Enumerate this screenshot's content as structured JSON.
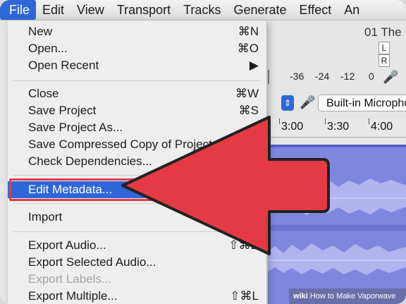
{
  "menubar": {
    "items": [
      "File",
      "Edit",
      "View",
      "Transport",
      "Tracks",
      "Generate",
      "Effect",
      "An"
    ]
  },
  "background": {
    "project_title": "01 The",
    "meter_channels": [
      "L",
      "R"
    ],
    "meter_db_labels": [
      "-36",
      "-24",
      "-12",
      "0"
    ],
    "input_device": "Built-in Microphone",
    "timeline_labels": [
      "3:00",
      "3:30",
      "4:00"
    ],
    "waveform_color": "#7f86de"
  },
  "file_menu": {
    "items": [
      {
        "label": "New",
        "shortcut": "⌘N"
      },
      {
        "label": "Open...",
        "shortcut": "⌘O"
      },
      {
        "label": "Open Recent",
        "shortcut": "▶"
      },
      {
        "label": "Close",
        "shortcut": "⌘W"
      },
      {
        "label": "Save Project",
        "shortcut": "⌘S"
      },
      {
        "label": "Save Project As...",
        "shortcut": ""
      },
      {
        "label": "Save Compressed Copy of Project...",
        "shortcut": ""
      },
      {
        "label": "Check Dependencies...",
        "shortcut": ""
      },
      {
        "label": "Edit Metadata...",
        "shortcut": ""
      },
      {
        "label": "Import",
        "shortcut": ""
      },
      {
        "label": "Export Audio...",
        "shortcut": "⇧⌘E"
      },
      {
        "label": "Export Selected Audio...",
        "shortcut": ""
      },
      {
        "label": "Export Labels...",
        "shortcut": ""
      },
      {
        "label": "Export Multiple...",
        "shortcut": "⇧⌘L"
      }
    ],
    "highlighted_index": 8,
    "disabled_indices": [
      12
    ],
    "highlight_color": "#2f67d8",
    "callout_color": "#e43a45"
  },
  "watermark": {
    "brand": "wiki",
    "text": "How to Make Vaporwave"
  }
}
